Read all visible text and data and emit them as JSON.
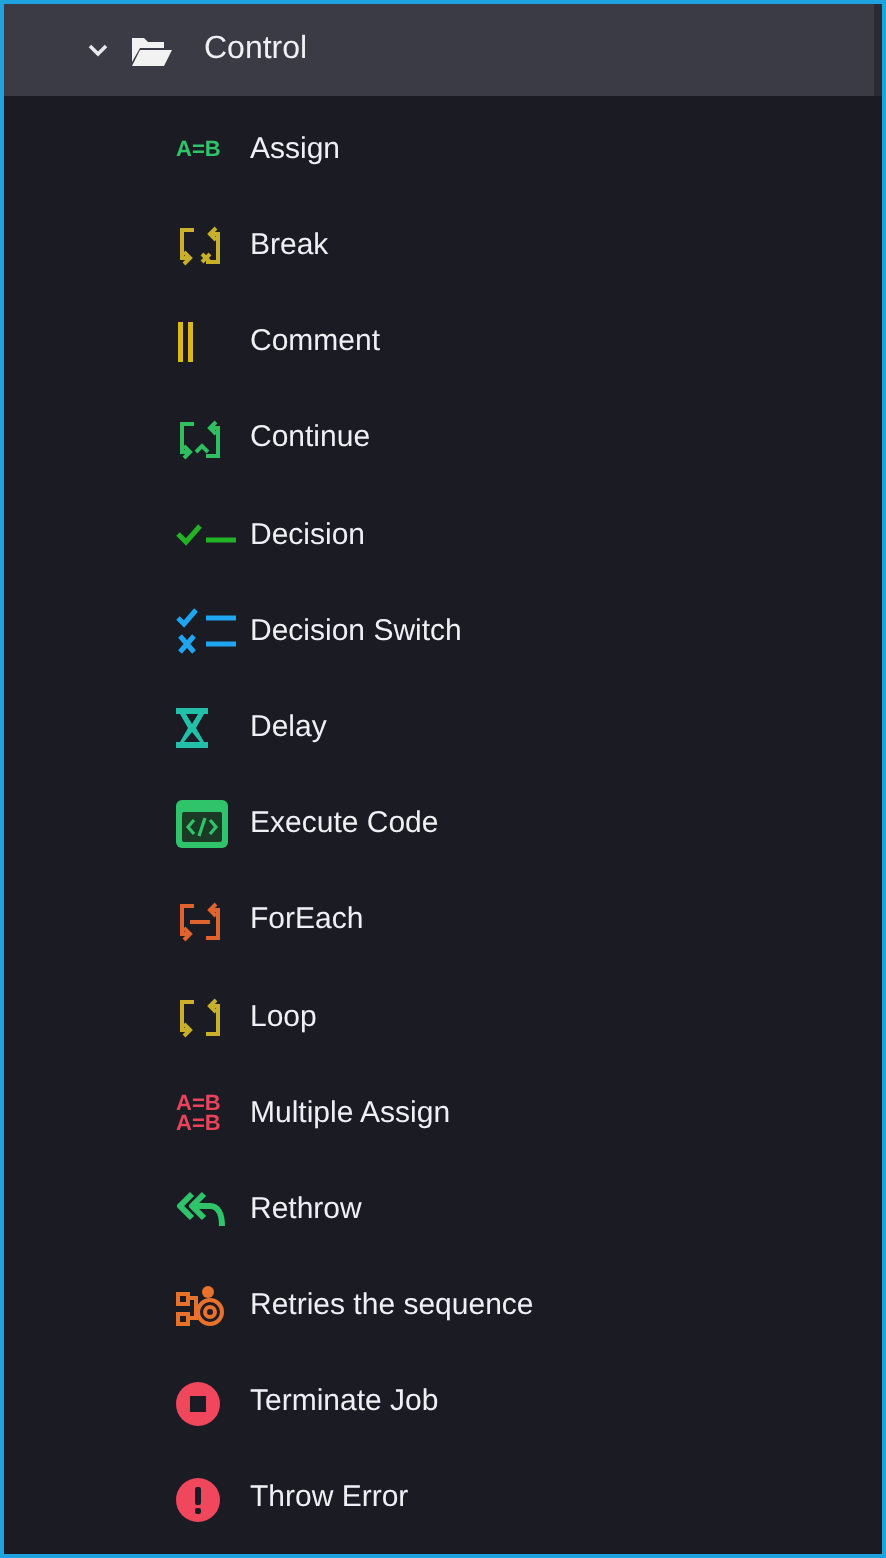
{
  "tree": {
    "folder": {
      "label": "Control",
      "expanded": true
    },
    "items": [
      {
        "label": "Assign",
        "kind": "assign",
        "color": "#2fc46a",
        "icon_text": [
          "A=B"
        ]
      },
      {
        "label": "Break",
        "kind": "break",
        "color": "#c9b02a"
      },
      {
        "label": "Comment",
        "kind": "comment",
        "color": "#d9b81c"
      },
      {
        "label": "Continue",
        "kind": "continue",
        "color": "#2fbf5f"
      },
      {
        "label": "Decision",
        "kind": "decision",
        "color": "#22b322"
      },
      {
        "label": "Decision Switch",
        "kind": "switch",
        "color": "#1ea7f0"
      },
      {
        "label": "Delay",
        "kind": "delay",
        "color": "#22c0a8"
      },
      {
        "label": "Execute Code",
        "kind": "code",
        "color": "#2fc46a"
      },
      {
        "label": "ForEach",
        "kind": "foreach",
        "color": "#e0622c"
      },
      {
        "label": "Loop",
        "kind": "loop",
        "color": "#c9b02a"
      },
      {
        "label": "Multiple Assign",
        "kind": "assign",
        "color": "#e8435a",
        "icon_text": [
          "A=B",
          "A=B"
        ]
      },
      {
        "label": "Rethrow",
        "kind": "rethrow",
        "color": "#2fc46a"
      },
      {
        "label": "Retries the sequence",
        "kind": "retry",
        "color": "#e8712c"
      },
      {
        "label": "Terminate Job",
        "kind": "terminate",
        "color": "#f0475d"
      },
      {
        "label": "Throw Error",
        "kind": "error",
        "color": "#f0475d"
      }
    ]
  }
}
